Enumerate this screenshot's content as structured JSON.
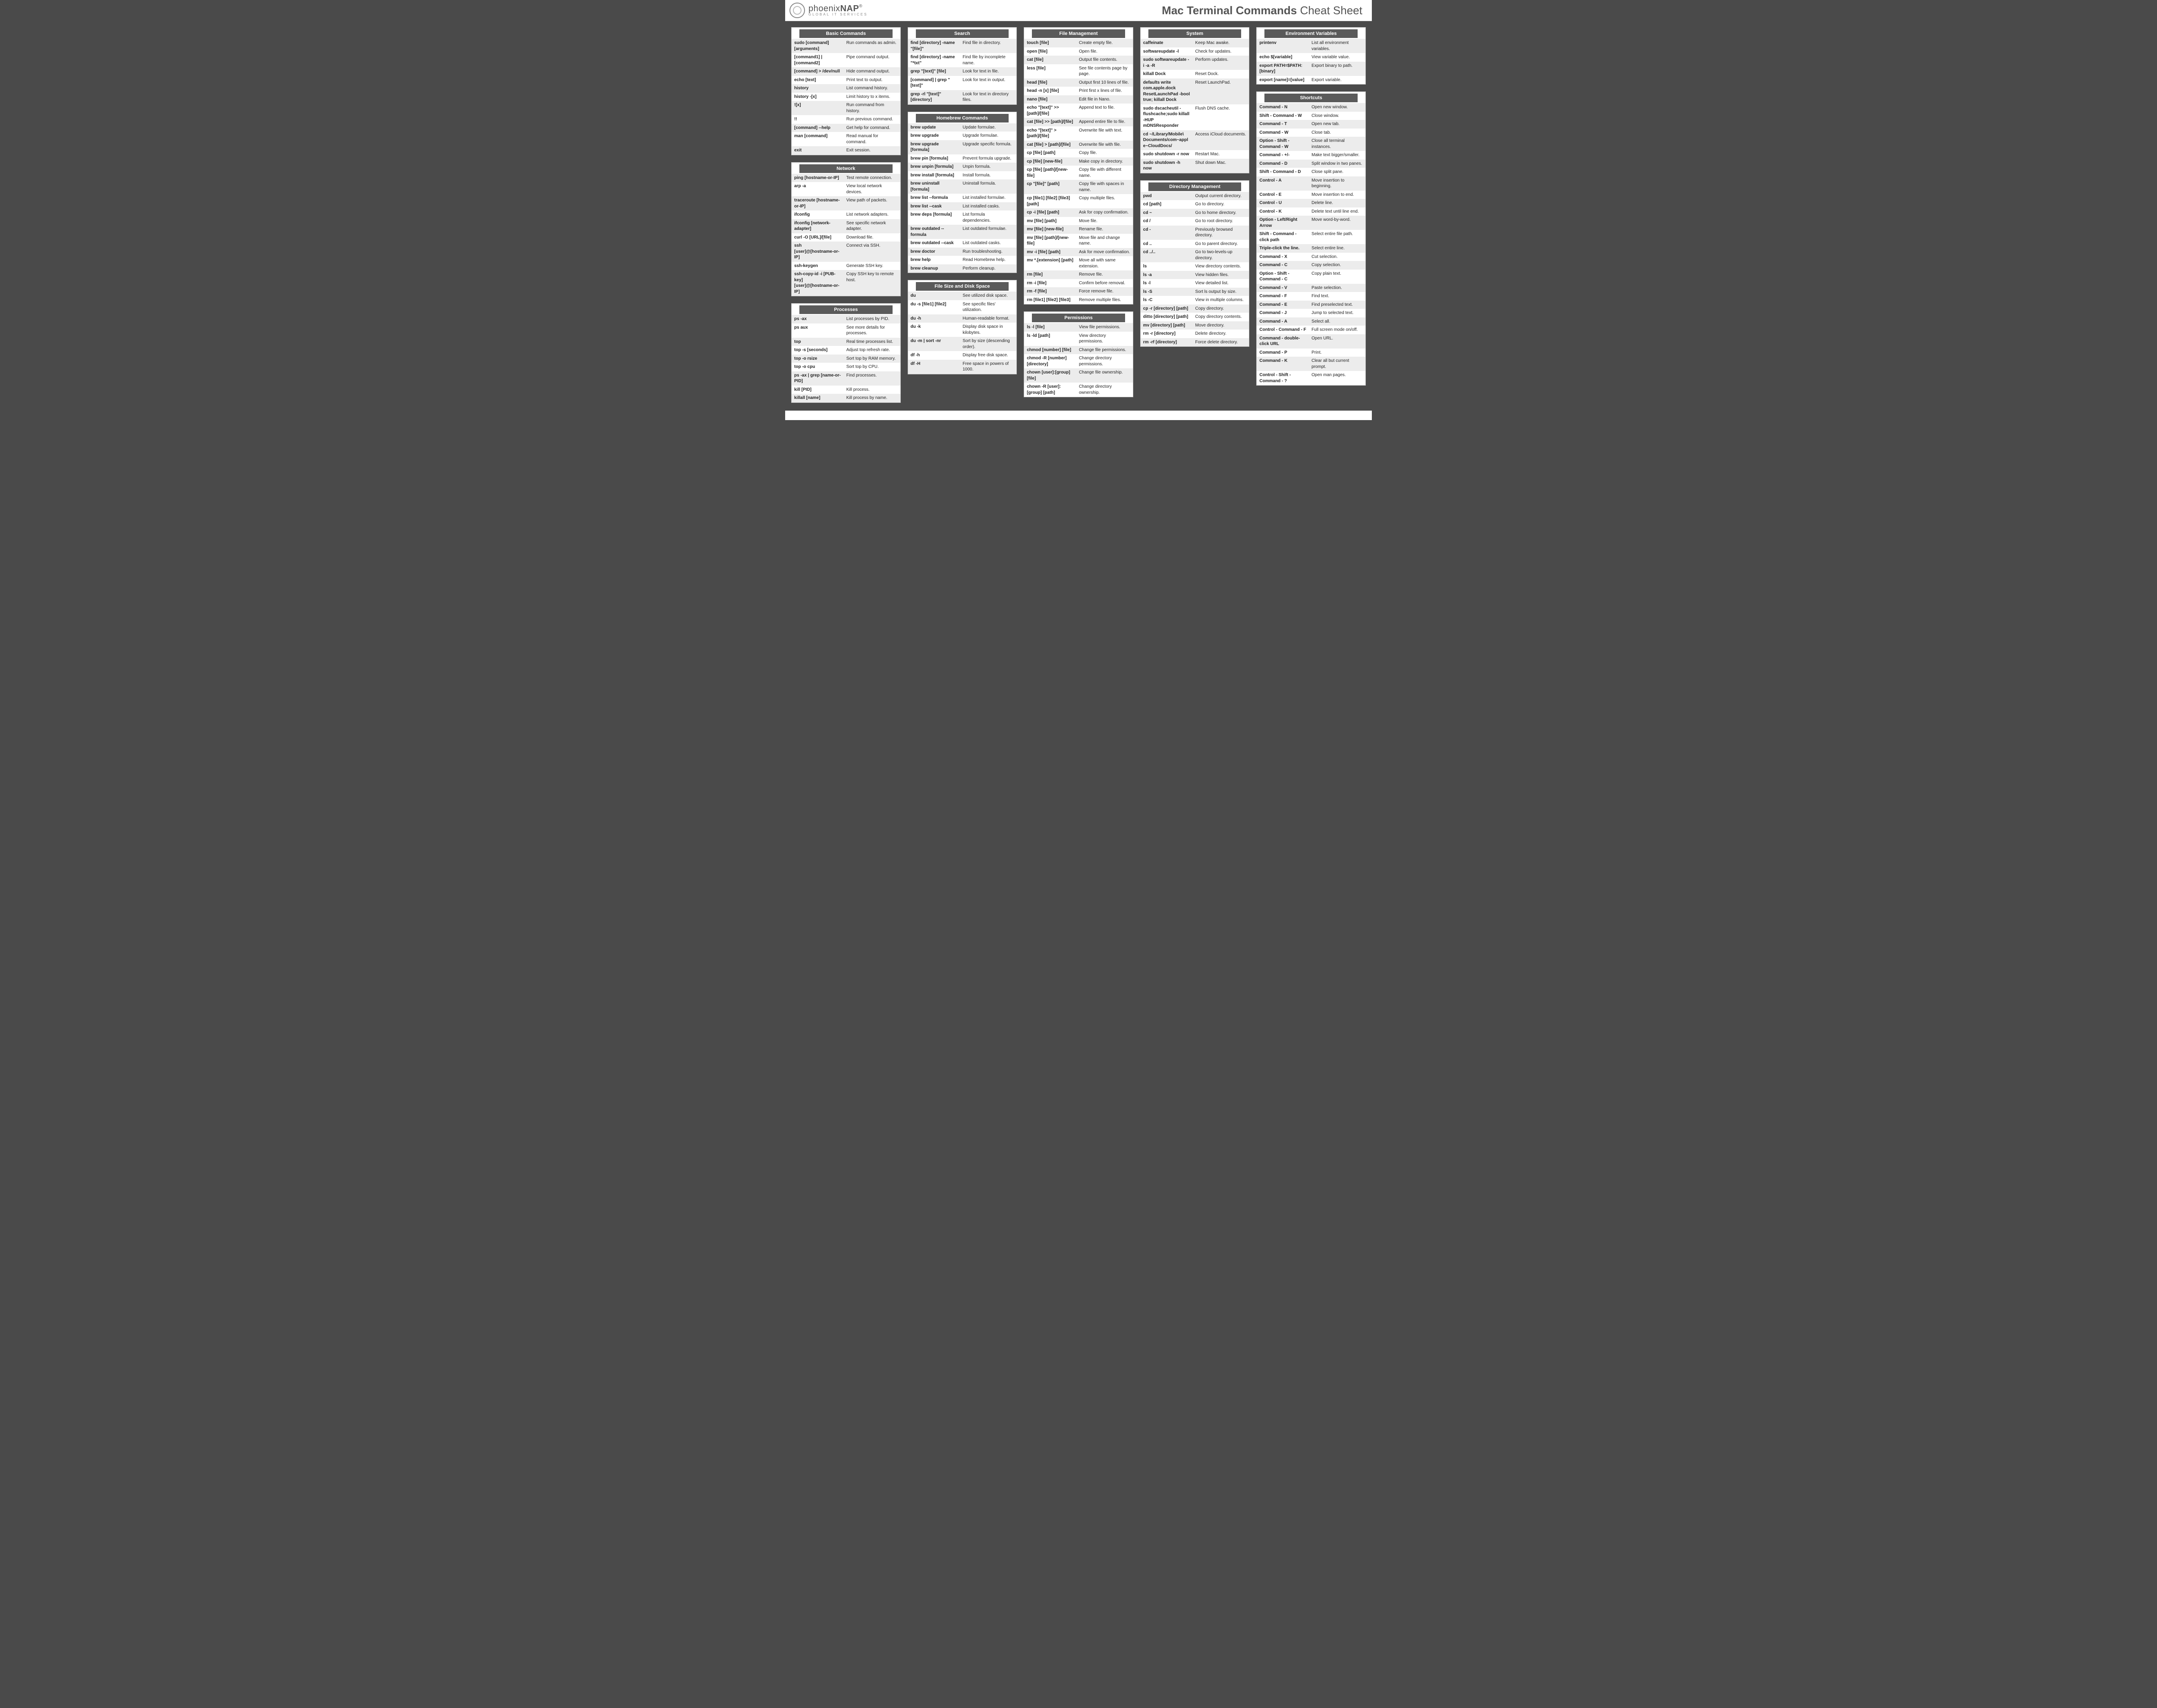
{
  "brand": {
    "name_lc": "phoenix",
    "name_uc": "NAP",
    "reg": "®",
    "tagline": "GLOBAL IT SERVICES"
  },
  "title_bold": "Mac Terminal Commands",
  "title_light": " Cheat Sheet",
  "columns": [
    [
      {
        "title": "Basic Commands",
        "rows": [
          [
            "sudo [command] [arguments]",
            "Run commands as admin."
          ],
          [
            "[command1] | [command2]",
            "Pipe command output."
          ],
          [
            "[command] > /dev/null",
            "Hide command output."
          ],
          [
            "echo [text]",
            "Print text to output."
          ],
          [
            "history",
            "List command history."
          ],
          [
            "history -[x]",
            "Limit history to x items."
          ],
          [
            "![x]",
            "Run command from history."
          ],
          [
            "!!",
            "Run previous command."
          ],
          [
            "[command] --help",
            "Get help for command."
          ],
          [
            "man [command]",
            "Read manual for command."
          ],
          [
            "exit",
            "Exit session."
          ]
        ]
      },
      {
        "title": "Network",
        "rows": [
          [
            "ping [hostname-or-IP]",
            "Test remote connection."
          ],
          [
            "arp -a",
            "View local network devices."
          ],
          [
            "traceroute [hostname-or-IP]",
            "View path of packets."
          ],
          [
            "ifconfig",
            "List network adapters."
          ],
          [
            "ifconfig [network-adapter]",
            "See specific network adapter."
          ],
          [
            "curl -O [URL]/[file]",
            "Download file."
          ],
          [
            "ssh [user]@[hostname-or-IP]",
            "Connect via SSH."
          ],
          [
            "ssh-keygen",
            "Generate SSH key."
          ],
          [
            "ssh-copy-id -i [PUB-key] [user]@[hostname-or-IP]",
            "Copy SSH key to remote host."
          ]
        ]
      },
      {
        "title": "Processes",
        "rows": [
          [
            "ps -ax",
            "List processes by PID."
          ],
          [
            "ps aux",
            "See more details for processes."
          ],
          [
            "top",
            "Real time processes list."
          ],
          [
            "top -s [seconds]",
            "Adjust top refresh rate."
          ],
          [
            "top -o rsize",
            "Sort top by RAM memory."
          ],
          [
            "top -o cpu",
            "Sort top by CPU."
          ],
          [
            "ps -ax | grep [name-or-PID]",
            "Find processes."
          ],
          [
            "kill [PID]",
            "Kill process."
          ],
          [
            "killall [name]",
            "Kill process by name."
          ]
        ]
      }
    ],
    [
      {
        "title": "Search",
        "rows": [
          [
            "find [directory] -name \"[file]\"",
            "Find file in directory."
          ],
          [
            "find [directory] -name \"*txt\"",
            "Find file by incomplete name."
          ],
          [
            "grep \"[text]\" [file]",
            "Look for text in file."
          ],
          [
            "[command] | grep \"[text]\"",
            "Look for text in output."
          ],
          [
            "grep -rl \"[text]\" [directory]",
            "Look for text in directory files."
          ]
        ]
      },
      {
        "title": "Homebrew Commands",
        "rows": [
          [
            "brew update",
            "Update formulae."
          ],
          [
            "brew upgrade",
            "Upgrade formulae."
          ],
          [
            "brew upgrade [formula]",
            "Upgrade specific formula."
          ],
          [
            "brew pin [formula]",
            "Prevent formula upgrade."
          ],
          [
            "brew unpin [formula]",
            "Unpin formula."
          ],
          [
            "brew install [formula]",
            "Install formula."
          ],
          [
            "brew uninstall [formula]",
            "Uninstall formula."
          ],
          [
            "brew list --formula",
            "List installed formulae."
          ],
          [
            "brew list --cask",
            "List installed casks."
          ],
          [
            "brew deps [formula]",
            "List formula dependencies."
          ],
          [
            "brew outdated --formula",
            "List outdated formulae."
          ],
          [
            "brew outdated --cask",
            "List outdated casks."
          ],
          [
            "brew doctor",
            "Run troubleshooting."
          ],
          [
            "brew help",
            "Read Homebrew help."
          ],
          [
            "brew cleanup",
            "Perform cleanup."
          ]
        ]
      },
      {
        "title": "File Size and Disk Space",
        "rows": [
          [
            "du",
            "See utilized disk space."
          ],
          [
            "du -s [file1] [file2]",
            "See specific files' utilization."
          ],
          [
            "du -h",
            "Human-readable format."
          ],
          [
            "du -k",
            "Display disk space in kilobytes."
          ],
          [
            "du -m | sort -nr",
            "Sort by size (descending order)."
          ],
          [
            "df -h",
            "Display free disk space."
          ],
          [
            "df -H",
            "Free space in powers of 1000."
          ]
        ]
      }
    ],
    [
      {
        "title": "File Management",
        "rows": [
          [
            "touch [file]",
            "Create empty file."
          ],
          [
            "open [file]",
            "Open file."
          ],
          [
            "cat [file]",
            "Output file contents."
          ],
          [
            "less [file]",
            "See file contents page by page."
          ],
          [
            "head [file]",
            "Output first 10 lines of file."
          ],
          [
            "head -n [x] [file]",
            "Print first x lines of file."
          ],
          [
            "nano [file]",
            "Edit file in Nano."
          ],
          [
            "echo \"[text]\" >> [path]/[file]",
            "Append text to file."
          ],
          [
            "cat [file] >> [path]/[file]",
            "Append entire file to file."
          ],
          [
            "echo \"[text]\" > [path]/[file]",
            "Overwrite file with text."
          ],
          [
            "cat [file] > [path]/[file]",
            "Overwrite file with file."
          ],
          [
            "cp [file] [path]",
            "Copy file."
          ],
          [
            "cp [file] [new-file]",
            "Make copy in directory."
          ],
          [
            "cp [file] [path]/[new-file]",
            "Copy file with different name."
          ],
          [
            "cp \"[file]\" [path]",
            "Copy file with spaces in name."
          ],
          [
            "cp [file1] [file2] [file3] [path]",
            "Copy multiple files."
          ],
          [
            "cp -i [file] [path]",
            "Ask for copy confirmation."
          ],
          [
            "mv [file] [path]",
            "Move file."
          ],
          [
            "mv [file] [new-file]",
            "Rename file."
          ],
          [
            "mv [file] [path]/[new-file]",
            "Move file and change name."
          ],
          [
            "mv -i [file] [path]",
            "Ask for move confirmation."
          ],
          [
            "mv *.[extension] [path]",
            "Move all with same extension."
          ],
          [
            "rm [file]",
            "Remove file."
          ],
          [
            "rm -i [file]",
            "Confirm before removal."
          ],
          [
            "rm -f [file]",
            "Force remove file."
          ],
          [
            "rm [file1] [file2] [file3]",
            "Remove multiple files."
          ]
        ]
      },
      {
        "title": "Permissions",
        "rows": [
          [
            "ls -l [file]",
            "View file permissions."
          ],
          [
            "ls -ld [path]",
            "View directory permissions."
          ],
          [
            "chmod [number] [file]",
            "Change file permissions."
          ],
          [
            "chmod -R [number] [directory]",
            "Change directory permissions."
          ],
          [
            "chown [user]:[group] [file]",
            "Change file ownership."
          ],
          [
            "chown -R [user]:[group] [path]",
            "Change directory ownership."
          ]
        ]
      }
    ],
    [
      {
        "title": "System",
        "rows": [
          [
            "caffeinate",
            "Keep Mac awake."
          ],
          [
            "softwareupdate -l",
            "Check for updates."
          ],
          [
            "sudo softwareupdate -i -a -R",
            "Perform updates."
          ],
          [
            "killall Dock",
            "Reset Dock."
          ],
          [
            "defaults write com.apple.dock ResetLaunchPad -bool true; killall Dock",
            "Reset LaunchPad."
          ],
          [
            "sudo dscacheutil -flushcache;sudo killall -HUP mDNSResponder",
            "Flush DNS cache."
          ],
          [
            "cd ~/Library/Mobile\\ Documents/com~apple~CloudDocs/",
            "Access iCloud documents."
          ],
          [
            "sudo shutdown -r now",
            "Restart Mac."
          ],
          [
            "sudo shutdown -h now",
            "Shut down Mac."
          ]
        ]
      },
      {
        "title": "Directory Management",
        "rows": [
          [
            "pwd",
            "Output current directory."
          ],
          [
            "cd [path]",
            "Go to directory."
          ],
          [
            "cd ~",
            "Go to home directory."
          ],
          [
            "cd /",
            "Go to root directory."
          ],
          [
            "cd -",
            "Previously browsed directory."
          ],
          [
            "cd ..",
            "Go to parent directory."
          ],
          [
            "cd ../..",
            "Go to two-levels-up directory."
          ],
          [
            "ls",
            "View directory contents."
          ],
          [
            "ls -a",
            "View hidden files."
          ],
          [
            "ls -l",
            "View detailed list."
          ],
          [
            "ls -S",
            "Sort ls output by size."
          ],
          [
            "ls -C",
            "View in multiple columns."
          ],
          [
            "cp -r [directory] [path]",
            "Copy directory."
          ],
          [
            "ditto [directory] [path]",
            "Copy directory contents."
          ],
          [
            "mv [directory] [path]",
            "Move directory."
          ],
          [
            "rm -r [directory]",
            "Delete directory."
          ],
          [
            "rm -rf [directory]",
            "Force delete directory."
          ]
        ]
      }
    ],
    [
      {
        "title": "Environment Variables",
        "rows": [
          [
            "printenv",
            "List all environment variables."
          ],
          [
            "echo $[variable]",
            "View variable value."
          ],
          [
            "export PATH=$PATH:[binary]",
            "Export binary to path."
          ],
          [
            "export [name]=[value]",
            "Export variable."
          ]
        ]
      },
      {
        "title": "Shortcuts",
        "rows": [
          [
            "Command - N",
            "Open new window."
          ],
          [
            "Shift - Command - W",
            "Close window."
          ],
          [
            "Command - T",
            "Open new tab."
          ],
          [
            "Command - W",
            "Close tab."
          ],
          [
            "Option - Shift - Command - W",
            "Close all terminal instances."
          ],
          [
            "Command - +/-",
            "Make text bigger/smaller."
          ],
          [
            "Command - D",
            "Split window in two panes."
          ],
          [
            "Shift - Command - D",
            "Close split pane."
          ],
          [
            "Control - A",
            "Move insertion to beginning."
          ],
          [
            "Control - E",
            "Move insertion to end."
          ],
          [
            "Control - U",
            "Delete line."
          ],
          [
            "Control - K",
            "Delete text until line end."
          ],
          [
            "Option - Left/Right Arrow",
            "Move word-by-word."
          ],
          [
            "Shift - Command - click path",
            "Select entire file path."
          ],
          [
            "Triple-click the line.",
            "Select entire line."
          ],
          [
            "Command - X",
            "Cut selection."
          ],
          [
            "Command - C",
            "Copy selection."
          ],
          [
            "Option - Shift - Command - C",
            "Copy plain text."
          ],
          [
            "Command - V",
            "Paste selection."
          ],
          [
            "Command - F",
            "Find text."
          ],
          [
            "Command - E",
            "Find preselected text."
          ],
          [
            "Command - J",
            "Jump to selected text."
          ],
          [
            "Command - A",
            "Select all."
          ],
          [
            "Control - Command - F",
            "Full screen mode on/off."
          ],
          [
            "Command - double-click URL",
            "Open URL."
          ],
          [
            "Command - P",
            "Print."
          ],
          [
            "Command - K",
            "Clear all but current prompt."
          ],
          [
            "Control - Shift - Command - ?",
            "Open man pages."
          ]
        ]
      }
    ]
  ]
}
